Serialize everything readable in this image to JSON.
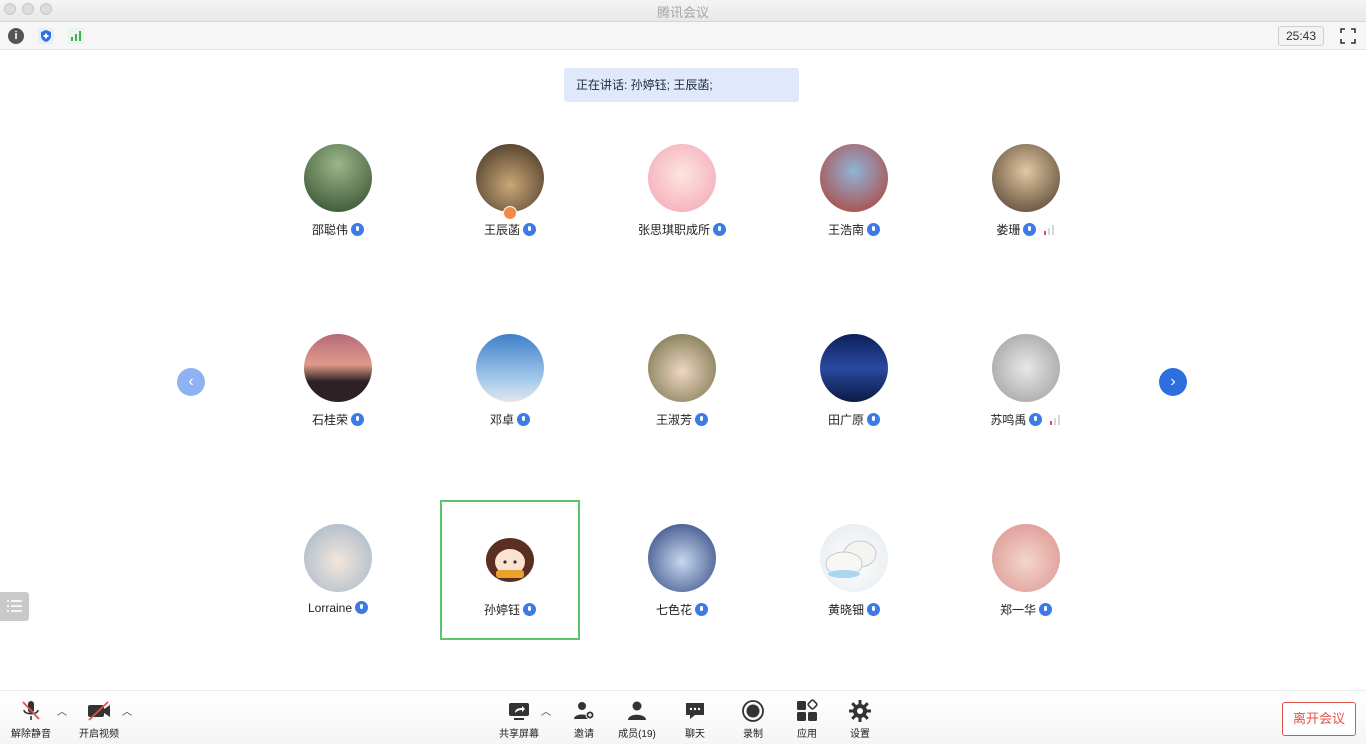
{
  "window": {
    "title": "腾讯会议"
  },
  "topbar": {
    "timer": "25:43"
  },
  "speaking": {
    "text": "正在讲话: 孙婷钰; 王辰菡;"
  },
  "participants": [
    {
      "name": "邵聪伟"
    },
    {
      "name": "王辰菡"
    },
    {
      "name": "张思琪职成所"
    },
    {
      "name": "王浩南"
    },
    {
      "name": "娄珊"
    },
    {
      "name": "石桂荣"
    },
    {
      "name": "邓卓"
    },
    {
      "name": "王淑芳"
    },
    {
      "name": "田广原"
    },
    {
      "name": "苏鸣禹"
    },
    {
      "name": "Lorraine"
    },
    {
      "name": "孙婷钰"
    },
    {
      "name": "七色花"
    },
    {
      "name": "黄晓钿"
    },
    {
      "name": "郑一华"
    }
  ],
  "toolbar": {
    "unmute": "解除静音",
    "video": "开启视频",
    "share": "共享屏幕",
    "invite": "邀请",
    "members": "成员(19)",
    "chat": "聊天",
    "record": "录制",
    "apps": "应用",
    "settings": "设置",
    "leave": "离开会议"
  },
  "colors": {
    "accent": "#2e6fe0",
    "active_border": "#5cc46b",
    "leave": "#e0534a",
    "speaking_bg": "#dfe9fb"
  }
}
